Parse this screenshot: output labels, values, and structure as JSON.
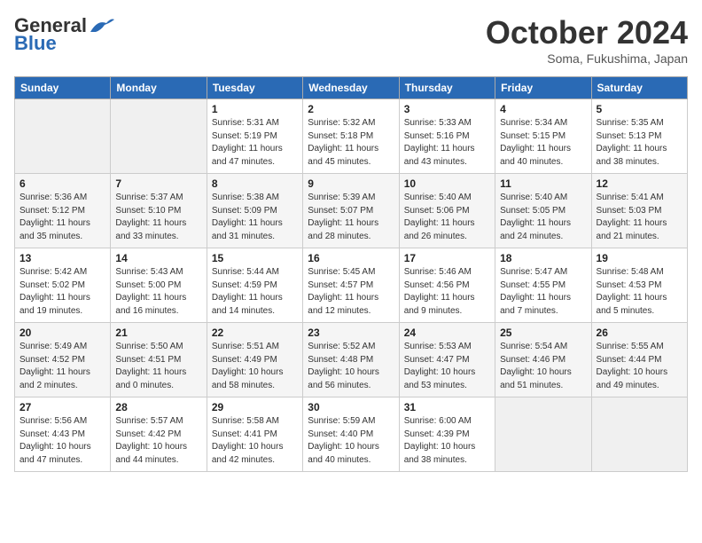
{
  "header": {
    "logo_general": "General",
    "logo_blue": "Blue",
    "month": "October 2024",
    "location": "Soma, Fukushima, Japan"
  },
  "weekdays": [
    "Sunday",
    "Monday",
    "Tuesday",
    "Wednesday",
    "Thursday",
    "Friday",
    "Saturday"
  ],
  "weeks": [
    [
      {
        "day": "",
        "sunrise": "",
        "sunset": "",
        "daylight": ""
      },
      {
        "day": "",
        "sunrise": "",
        "sunset": "",
        "daylight": ""
      },
      {
        "day": "1",
        "sunrise": "Sunrise: 5:31 AM",
        "sunset": "Sunset: 5:19 PM",
        "daylight": "Daylight: 11 hours and 47 minutes."
      },
      {
        "day": "2",
        "sunrise": "Sunrise: 5:32 AM",
        "sunset": "Sunset: 5:18 PM",
        "daylight": "Daylight: 11 hours and 45 minutes."
      },
      {
        "day": "3",
        "sunrise": "Sunrise: 5:33 AM",
        "sunset": "Sunset: 5:16 PM",
        "daylight": "Daylight: 11 hours and 43 minutes."
      },
      {
        "day": "4",
        "sunrise": "Sunrise: 5:34 AM",
        "sunset": "Sunset: 5:15 PM",
        "daylight": "Daylight: 11 hours and 40 minutes."
      },
      {
        "day": "5",
        "sunrise": "Sunrise: 5:35 AM",
        "sunset": "Sunset: 5:13 PM",
        "daylight": "Daylight: 11 hours and 38 minutes."
      }
    ],
    [
      {
        "day": "6",
        "sunrise": "Sunrise: 5:36 AM",
        "sunset": "Sunset: 5:12 PM",
        "daylight": "Daylight: 11 hours and 35 minutes."
      },
      {
        "day": "7",
        "sunrise": "Sunrise: 5:37 AM",
        "sunset": "Sunset: 5:10 PM",
        "daylight": "Daylight: 11 hours and 33 minutes."
      },
      {
        "day": "8",
        "sunrise": "Sunrise: 5:38 AM",
        "sunset": "Sunset: 5:09 PM",
        "daylight": "Daylight: 11 hours and 31 minutes."
      },
      {
        "day": "9",
        "sunrise": "Sunrise: 5:39 AM",
        "sunset": "Sunset: 5:07 PM",
        "daylight": "Daylight: 11 hours and 28 minutes."
      },
      {
        "day": "10",
        "sunrise": "Sunrise: 5:40 AM",
        "sunset": "Sunset: 5:06 PM",
        "daylight": "Daylight: 11 hours and 26 minutes."
      },
      {
        "day": "11",
        "sunrise": "Sunrise: 5:40 AM",
        "sunset": "Sunset: 5:05 PM",
        "daylight": "Daylight: 11 hours and 24 minutes."
      },
      {
        "day": "12",
        "sunrise": "Sunrise: 5:41 AM",
        "sunset": "Sunset: 5:03 PM",
        "daylight": "Daylight: 11 hours and 21 minutes."
      }
    ],
    [
      {
        "day": "13",
        "sunrise": "Sunrise: 5:42 AM",
        "sunset": "Sunset: 5:02 PM",
        "daylight": "Daylight: 11 hours and 19 minutes."
      },
      {
        "day": "14",
        "sunrise": "Sunrise: 5:43 AM",
        "sunset": "Sunset: 5:00 PM",
        "daylight": "Daylight: 11 hours and 16 minutes."
      },
      {
        "day": "15",
        "sunrise": "Sunrise: 5:44 AM",
        "sunset": "Sunset: 4:59 PM",
        "daylight": "Daylight: 11 hours and 14 minutes."
      },
      {
        "day": "16",
        "sunrise": "Sunrise: 5:45 AM",
        "sunset": "Sunset: 4:57 PM",
        "daylight": "Daylight: 11 hours and 12 minutes."
      },
      {
        "day": "17",
        "sunrise": "Sunrise: 5:46 AM",
        "sunset": "Sunset: 4:56 PM",
        "daylight": "Daylight: 11 hours and 9 minutes."
      },
      {
        "day": "18",
        "sunrise": "Sunrise: 5:47 AM",
        "sunset": "Sunset: 4:55 PM",
        "daylight": "Daylight: 11 hours and 7 minutes."
      },
      {
        "day": "19",
        "sunrise": "Sunrise: 5:48 AM",
        "sunset": "Sunset: 4:53 PM",
        "daylight": "Daylight: 11 hours and 5 minutes."
      }
    ],
    [
      {
        "day": "20",
        "sunrise": "Sunrise: 5:49 AM",
        "sunset": "Sunset: 4:52 PM",
        "daylight": "Daylight: 11 hours and 2 minutes."
      },
      {
        "day": "21",
        "sunrise": "Sunrise: 5:50 AM",
        "sunset": "Sunset: 4:51 PM",
        "daylight": "Daylight: 11 hours and 0 minutes."
      },
      {
        "day": "22",
        "sunrise": "Sunrise: 5:51 AM",
        "sunset": "Sunset: 4:49 PM",
        "daylight": "Daylight: 10 hours and 58 minutes."
      },
      {
        "day": "23",
        "sunrise": "Sunrise: 5:52 AM",
        "sunset": "Sunset: 4:48 PM",
        "daylight": "Daylight: 10 hours and 56 minutes."
      },
      {
        "day": "24",
        "sunrise": "Sunrise: 5:53 AM",
        "sunset": "Sunset: 4:47 PM",
        "daylight": "Daylight: 10 hours and 53 minutes."
      },
      {
        "day": "25",
        "sunrise": "Sunrise: 5:54 AM",
        "sunset": "Sunset: 4:46 PM",
        "daylight": "Daylight: 10 hours and 51 minutes."
      },
      {
        "day": "26",
        "sunrise": "Sunrise: 5:55 AM",
        "sunset": "Sunset: 4:44 PM",
        "daylight": "Daylight: 10 hours and 49 minutes."
      }
    ],
    [
      {
        "day": "27",
        "sunrise": "Sunrise: 5:56 AM",
        "sunset": "Sunset: 4:43 PM",
        "daylight": "Daylight: 10 hours and 47 minutes."
      },
      {
        "day": "28",
        "sunrise": "Sunrise: 5:57 AM",
        "sunset": "Sunset: 4:42 PM",
        "daylight": "Daylight: 10 hours and 44 minutes."
      },
      {
        "day": "29",
        "sunrise": "Sunrise: 5:58 AM",
        "sunset": "Sunset: 4:41 PM",
        "daylight": "Daylight: 10 hours and 42 minutes."
      },
      {
        "day": "30",
        "sunrise": "Sunrise: 5:59 AM",
        "sunset": "Sunset: 4:40 PM",
        "daylight": "Daylight: 10 hours and 40 minutes."
      },
      {
        "day": "31",
        "sunrise": "Sunrise: 6:00 AM",
        "sunset": "Sunset: 4:39 PM",
        "daylight": "Daylight: 10 hours and 38 minutes."
      },
      {
        "day": "",
        "sunrise": "",
        "sunset": "",
        "daylight": ""
      },
      {
        "day": "",
        "sunrise": "",
        "sunset": "",
        "daylight": ""
      }
    ]
  ]
}
